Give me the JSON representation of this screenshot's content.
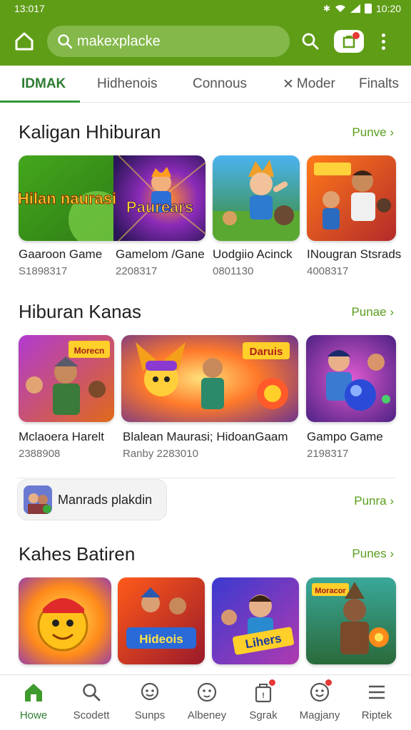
{
  "status": {
    "time_left": "13:017",
    "time_right": "10:20"
  },
  "colors": {
    "brand": "#5f9d17",
    "accent": "#5a9e1d",
    "active_tab": "#2e7d32",
    "badge": "#e53935"
  },
  "header": {
    "search_text": "makexplacke"
  },
  "tabs": [
    {
      "label": "IDMAK"
    },
    {
      "label": "Hidhenois"
    },
    {
      "label": "Connous"
    },
    {
      "label": "Moder"
    },
    {
      "label": "Finalts"
    }
  ],
  "sections": [
    {
      "title": "Kaligan Hhiburan",
      "more": "Punve",
      "cards": [
        {
          "title": "Gaaroon Game",
          "sub": "S1898317",
          "art": "Hilan naurasi"
        },
        {
          "title": "Gamelom /Gane",
          "sub": "2208317",
          "art": "Paurears"
        },
        {
          "title": "Uodgiio Acinck",
          "sub": "0801130",
          "art": ""
        },
        {
          "title": "INougran Stsrads",
          "sub": "4008317",
          "art": ""
        }
      ]
    },
    {
      "title": "Hiburan Kanas",
      "more": "Punae",
      "cards": [
        {
          "title": "Mclaoera Harelt",
          "sub": "2388908",
          "art": "Morecn"
        },
        {
          "title": "Blalean Maurasi; HidoanGaam",
          "sub": "Ranby 2283010",
          "art": "Daruis"
        },
        {
          "title": "Gampo Game",
          "sub": "2198317",
          "art": ""
        }
      ]
    },
    {
      "title": "Kahes Batiren",
      "more": "Punes",
      "cards": [
        {
          "title": "",
          "sub": "",
          "art": ""
        },
        {
          "title": "",
          "sub": "",
          "art": "Hideois"
        },
        {
          "title": "",
          "sub": "",
          "art": "Lihers"
        },
        {
          "title": "",
          "sub": "",
          "art": "Moracor"
        }
      ]
    }
  ],
  "chip": {
    "label": "Manrads plakdin",
    "more": "Punra"
  },
  "bottom_nav": [
    {
      "label": "Howe",
      "icon": "home-icon"
    },
    {
      "label": "Scodett",
      "icon": "search-icon"
    },
    {
      "label": "Sunps",
      "icon": "chat-icon"
    },
    {
      "label": "Albeney",
      "icon": "face-icon"
    },
    {
      "label": "Sgrak",
      "icon": "bag-icon"
    },
    {
      "label": "Magjany",
      "icon": "smile-icon"
    },
    {
      "label": "Riptek",
      "icon": "menu-icon"
    }
  ]
}
